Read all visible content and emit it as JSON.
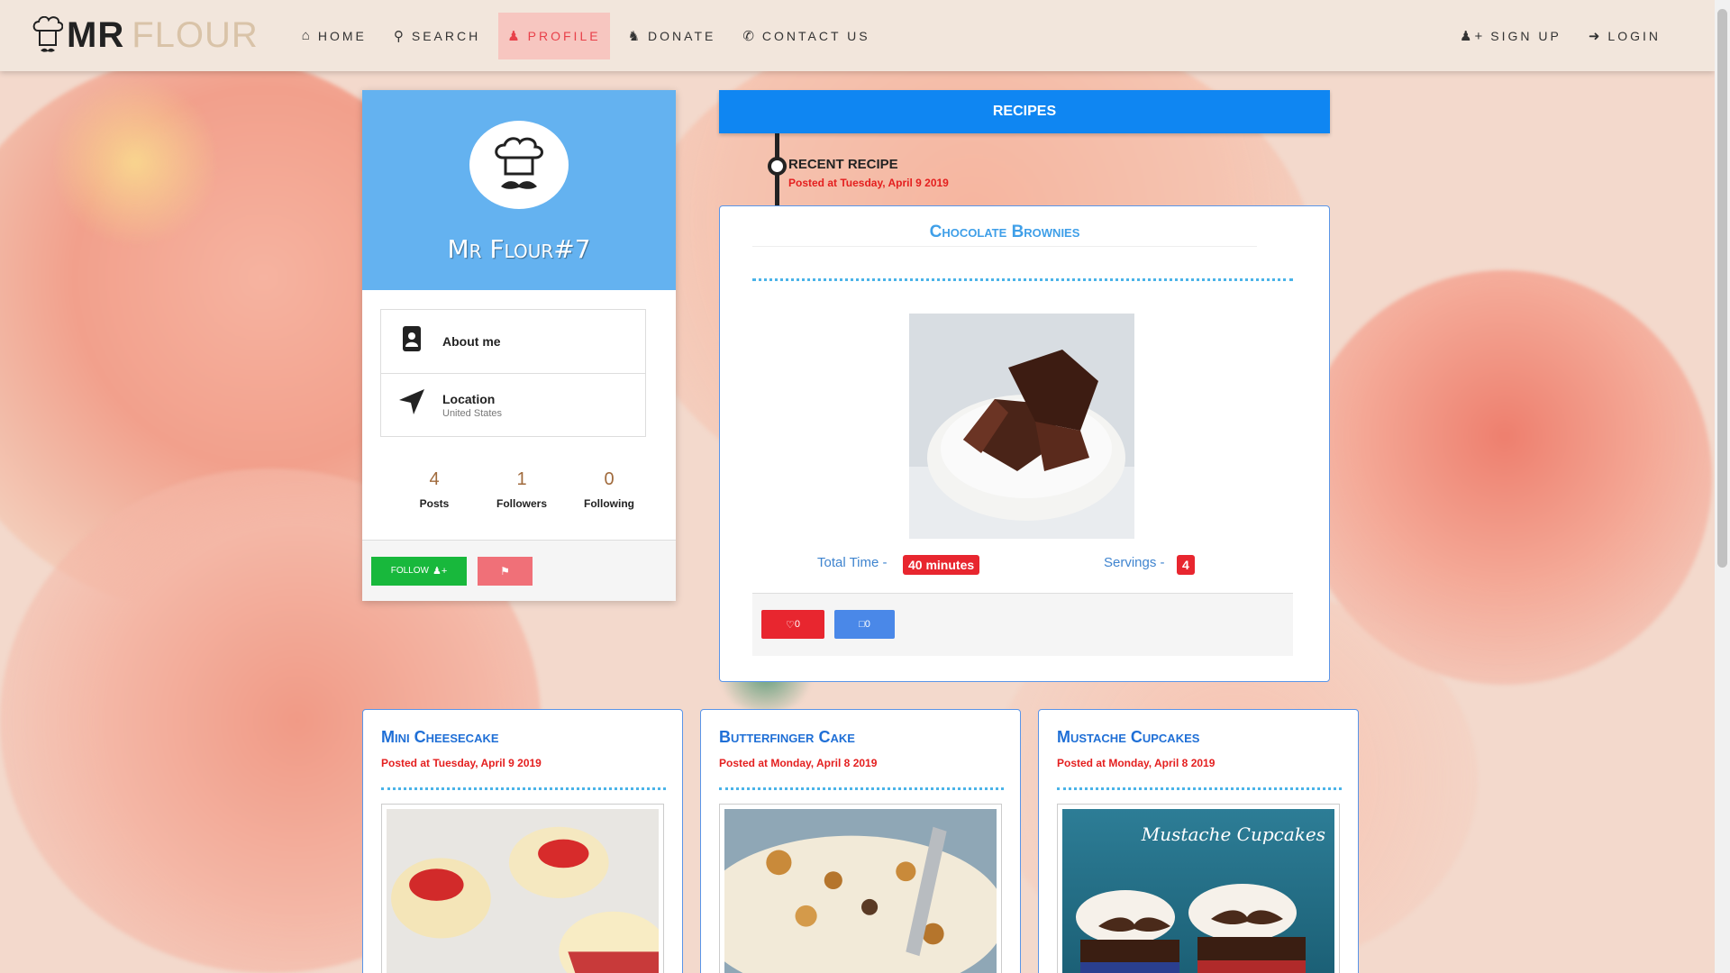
{
  "brand": {
    "mr": "MR",
    "flour": "FLOUR"
  },
  "nav": {
    "home": "HOME",
    "search": "SEARCH",
    "profile": "PROFILE",
    "donate": "DONATE",
    "contact": "CONTACT US",
    "signup": "SIGN UP",
    "login": "LOGIN"
  },
  "profile": {
    "username": "Mr Flour#7",
    "about_label": "About me",
    "location_label": "Location",
    "location_value": "United States",
    "stats": [
      {
        "num": "4",
        "label": "Posts"
      },
      {
        "num": "1",
        "label": "Followers"
      },
      {
        "num": "0",
        "label": "Following"
      }
    ],
    "follow_label": "FOLLOW"
  },
  "recipes": {
    "header": "RECIPES",
    "recent_title": "RECENT RECIPE",
    "recent_date": "Posted at Tuesday, April 9 2019",
    "featured": {
      "title": "Chocolate Brownies",
      "total_time_label": "Total Time -",
      "total_time_value": "40 minutes",
      "servings_label": "Servings -",
      "servings_value": "4",
      "likes": "0",
      "saves": "0"
    },
    "cards": [
      {
        "title": "Mini Cheesecake",
        "date": "Posted at Tuesday, April 9 2019"
      },
      {
        "title": "Butterfinger Cake",
        "date": "Posted at Monday, April 8 2019"
      },
      {
        "title": "Mustache Cupcakes",
        "date": "Posted at Monday, April 8 2019",
        "image_text": "Mustache Cupcakes"
      }
    ]
  },
  "colors": {
    "accent_blue": "#0f86f2",
    "profile_blue": "#64b2f0",
    "date_red": "#e41f1f",
    "follow_green": "#18b83c"
  }
}
